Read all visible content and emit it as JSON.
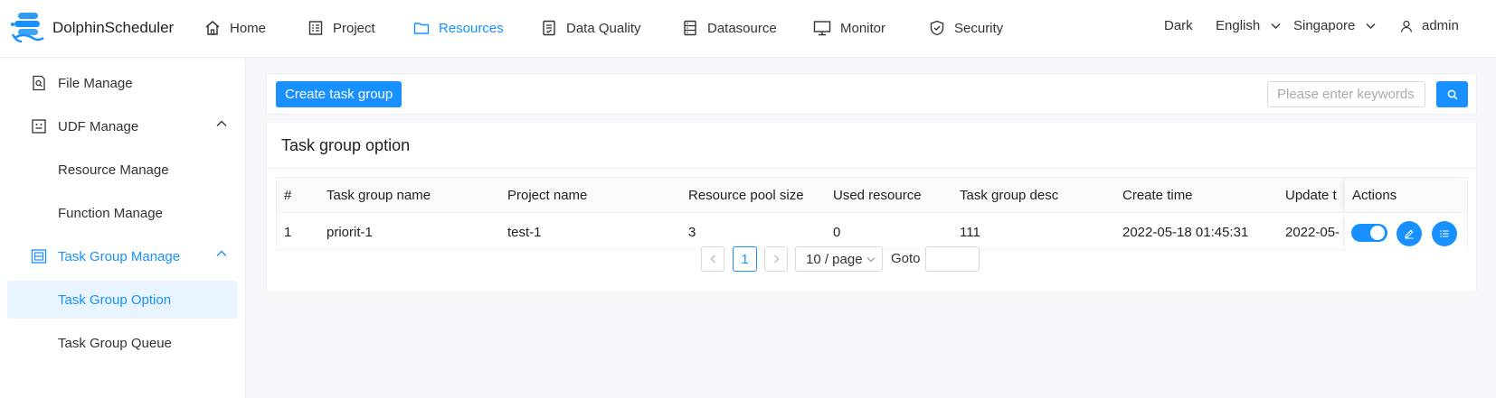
{
  "app": {
    "title": "DolphinScheduler"
  },
  "nav": {
    "home": "Home",
    "project": "Project",
    "resources": "Resources",
    "data_quality": "Data Quality",
    "datasource": "Datasource",
    "monitor": "Monitor",
    "security": "Security"
  },
  "header_right": {
    "theme": "Dark",
    "language": "English",
    "timezone": "Singapore",
    "user": "admin"
  },
  "sidebar": {
    "items": [
      {
        "label": "File Manage"
      },
      {
        "label": "UDF Manage"
      },
      {
        "label": "Resource Manage"
      },
      {
        "label": "Function Manage"
      },
      {
        "label": "Task Group Manage"
      },
      {
        "label": "Task Group Option"
      },
      {
        "label": "Task Group Queue"
      }
    ]
  },
  "toolbar": {
    "create_label": "Create task group",
    "search_placeholder": "Please enter keywords"
  },
  "card": {
    "title": "Task group option"
  },
  "table": {
    "columns": [
      "#",
      "Task group name",
      "Project name",
      "Resource pool size",
      "Used resource",
      "Task group desc",
      "Create time",
      "Update t",
      "Actions"
    ],
    "rows": [
      {
        "index": "1",
        "name": "priorit-1",
        "project": "test-1",
        "pool_size": "3",
        "used": "0",
        "desc": "111",
        "create_time": "2022-05-18 01:45:31",
        "update_time": "2022-05-",
        "enabled": true
      }
    ]
  },
  "pagination": {
    "current": "1",
    "page_size": "10 / page",
    "goto_label": "Goto",
    "goto_value": ""
  },
  "colors": {
    "primary": "#1890ff",
    "selected_bg": "#e8f4ff"
  }
}
